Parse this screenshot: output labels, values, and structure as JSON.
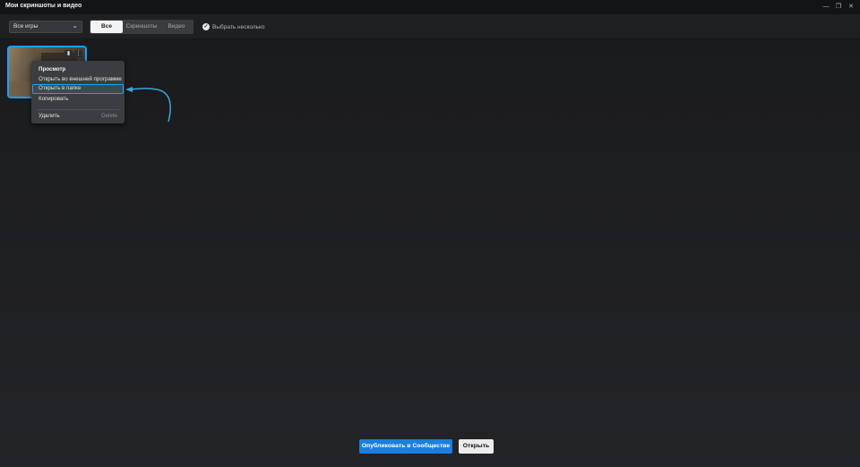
{
  "window": {
    "title": "Мои скриншоты и видео",
    "minimize_glyph": "—",
    "restore_glyph": "❐",
    "close_glyph": "✕"
  },
  "toolbar": {
    "game_filter": "Все игры",
    "tabs": [
      "Все",
      "Скриншоты",
      "Видео"
    ],
    "active_tab": "Все",
    "select_multiple": "Выбрать несколько"
  },
  "thumbnail": {
    "delete_icon": "trash-icon",
    "more_icon": "more-vertical-icon"
  },
  "context_menu": {
    "items": [
      {
        "label": "Просмотр",
        "shortcut": ""
      },
      {
        "label": "Открыть во внешней программе",
        "shortcut": ""
      },
      {
        "label": "Открыть в папке",
        "shortcut": ""
      },
      {
        "label": "Копировать",
        "shortcut": ""
      },
      {
        "label": "Удалить",
        "shortcut": "Delete"
      }
    ],
    "highlighted": "Открыть в папке"
  },
  "footer": {
    "publish_label": "Опубликовать в Сообществе",
    "open_label": "Открыть"
  },
  "colors": {
    "accent": "#1a9fff",
    "publish_button": "#1a7fe0",
    "background": "#1b1c1e"
  }
}
